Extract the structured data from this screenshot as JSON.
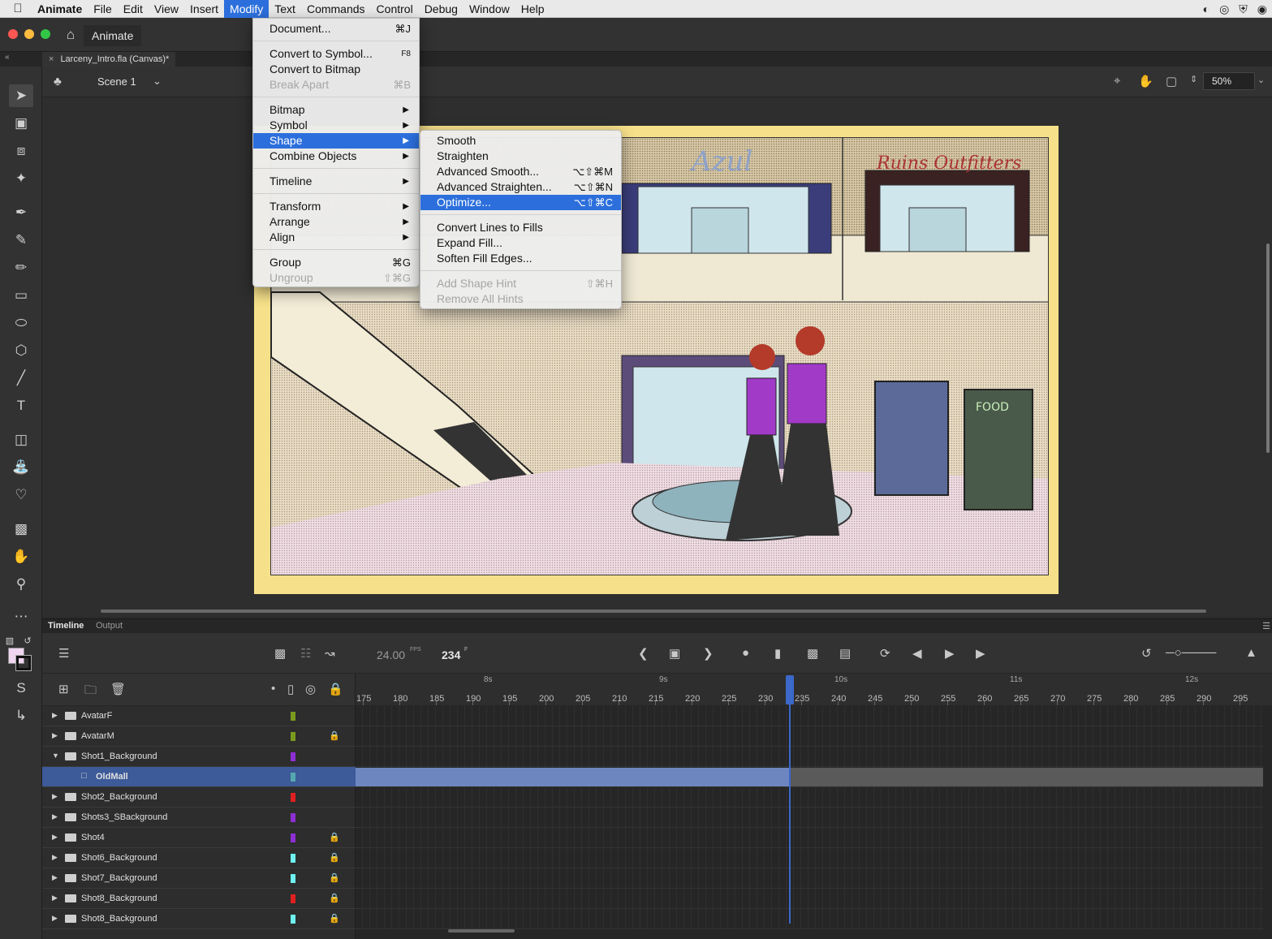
{
  "menubar": {
    "app_name": "Animate",
    "items": [
      "File",
      "Edit",
      "View",
      "Insert",
      "Modify",
      "Text",
      "Commands",
      "Control",
      "Debug",
      "Window",
      "Help"
    ],
    "active_item": "Modify"
  },
  "titlebar": {
    "app_tab": "Animate"
  },
  "document": {
    "tab_title": "Larceny_Intro.fla (Canvas)*"
  },
  "stage": {
    "scene_label": "Scene 1",
    "zoom": "50%",
    "stage_color": "#f6e08a"
  },
  "modify_menu": {
    "items": [
      {
        "label": "Document...",
        "shortcut": "⌘J",
        "enabled": true
      },
      {
        "label": "Convert to Symbol...",
        "shortcut": "F8",
        "enabled": true
      },
      {
        "label": "Convert to Bitmap",
        "shortcut": "",
        "enabled": true
      },
      {
        "label": "Break Apart",
        "shortcut": "⌘B",
        "enabled": false
      },
      {
        "label": "Bitmap",
        "shortcut": "",
        "enabled": true,
        "submenu": true
      },
      {
        "label": "Symbol",
        "shortcut": "",
        "enabled": true,
        "submenu": true
      },
      {
        "label": "Shape",
        "shortcut": "",
        "enabled": true,
        "submenu": true,
        "highlighted": true
      },
      {
        "label": "Combine Objects",
        "shortcut": "",
        "enabled": true,
        "submenu": true
      },
      {
        "label": "Timeline",
        "shortcut": "",
        "enabled": true,
        "submenu": true
      },
      {
        "label": "Transform",
        "shortcut": "",
        "enabled": true,
        "submenu": true
      },
      {
        "label": "Arrange",
        "shortcut": "",
        "enabled": true,
        "submenu": true
      },
      {
        "label": "Align",
        "shortcut": "",
        "enabled": true,
        "submenu": true
      },
      {
        "label": "Group",
        "shortcut": "⌘G",
        "enabled": true
      },
      {
        "label": "Ungroup",
        "shortcut": "⇧⌘G",
        "enabled": false
      }
    ]
  },
  "shape_submenu": {
    "items": [
      {
        "label": "Smooth",
        "shortcut": "",
        "enabled": true
      },
      {
        "label": "Straighten",
        "shortcut": "",
        "enabled": true
      },
      {
        "label": "Advanced Smooth...",
        "shortcut": "⌥⇧⌘M",
        "enabled": true
      },
      {
        "label": "Advanced Straighten...",
        "shortcut": "⌥⇧⌘N",
        "enabled": true
      },
      {
        "label": "Optimize...",
        "shortcut": "⌥⇧⌘C",
        "enabled": true,
        "highlighted": true
      },
      {
        "label": "Convert Lines to Fills",
        "shortcut": "",
        "enabled": true
      },
      {
        "label": "Expand Fill...",
        "shortcut": "",
        "enabled": true
      },
      {
        "label": "Soften Fill Edges...",
        "shortcut": "",
        "enabled": true
      },
      {
        "label": "Add Shape Hint",
        "shortcut": "⇧⌘H",
        "enabled": false
      },
      {
        "label": "Remove All Hints",
        "shortcut": "",
        "enabled": false
      }
    ]
  },
  "timeline": {
    "tabs": [
      "Timeline",
      "Output"
    ],
    "fps": "24.00",
    "fps_unit": "FPS",
    "current_frame": "234",
    "frame_unit": "F",
    "seconds_labels": [
      "8s",
      "9s",
      "10s",
      "11s",
      "12s"
    ],
    "frame_numbers": [
      "175",
      "180",
      "185",
      "190",
      "195",
      "200",
      "205",
      "210",
      "215",
      "220",
      "225",
      "230",
      "235",
      "240",
      "245",
      "250",
      "255",
      "260",
      "265",
      "270",
      "275",
      "280",
      "285",
      "290",
      "295"
    ],
    "layers": [
      {
        "name": "AvatarF",
        "color": "#7a9a1e",
        "locked": false,
        "expanded": false,
        "selected": false
      },
      {
        "name": "AvatarM",
        "color": "#7a9a1e",
        "locked": true,
        "expanded": false,
        "selected": false
      },
      {
        "name": "Shot1_Background",
        "color": "#8e2fd4",
        "locked": false,
        "expanded": true,
        "selected": false
      },
      {
        "name": "OldMall",
        "color": "#55a8b0",
        "locked": false,
        "expanded": false,
        "selected": true,
        "child": true
      },
      {
        "name": "Shot2_Background",
        "color": "#e02020",
        "locked": false,
        "expanded": false,
        "selected": false
      },
      {
        "name": "Shots3_SBackground",
        "color": "#8e2fd4",
        "locked": false,
        "expanded": false,
        "selected": false
      },
      {
        "name": "Shot4",
        "color": "#8e2fd4",
        "locked": true,
        "expanded": false,
        "selected": false
      },
      {
        "name": "Shot6_Background",
        "color": "#6ef0f0",
        "locked": true,
        "expanded": false,
        "selected": false
      },
      {
        "name": "Shot7_Background",
        "color": "#6ef0f0",
        "locked": true,
        "expanded": false,
        "selected": false
      },
      {
        "name": "Shot8_Background",
        "color": "#e02020",
        "locked": true,
        "expanded": false,
        "selected": false
      },
      {
        "name": "Shot8_Background",
        "color": "#6ef0f0",
        "locked": true,
        "expanded": false,
        "selected": false
      }
    ]
  },
  "colors": {
    "accent": "#2c6fdc",
    "selected_layer": "#3d5a99",
    "playhead": "#3b68c9",
    "fill_swatch": "#f0d5f0"
  }
}
